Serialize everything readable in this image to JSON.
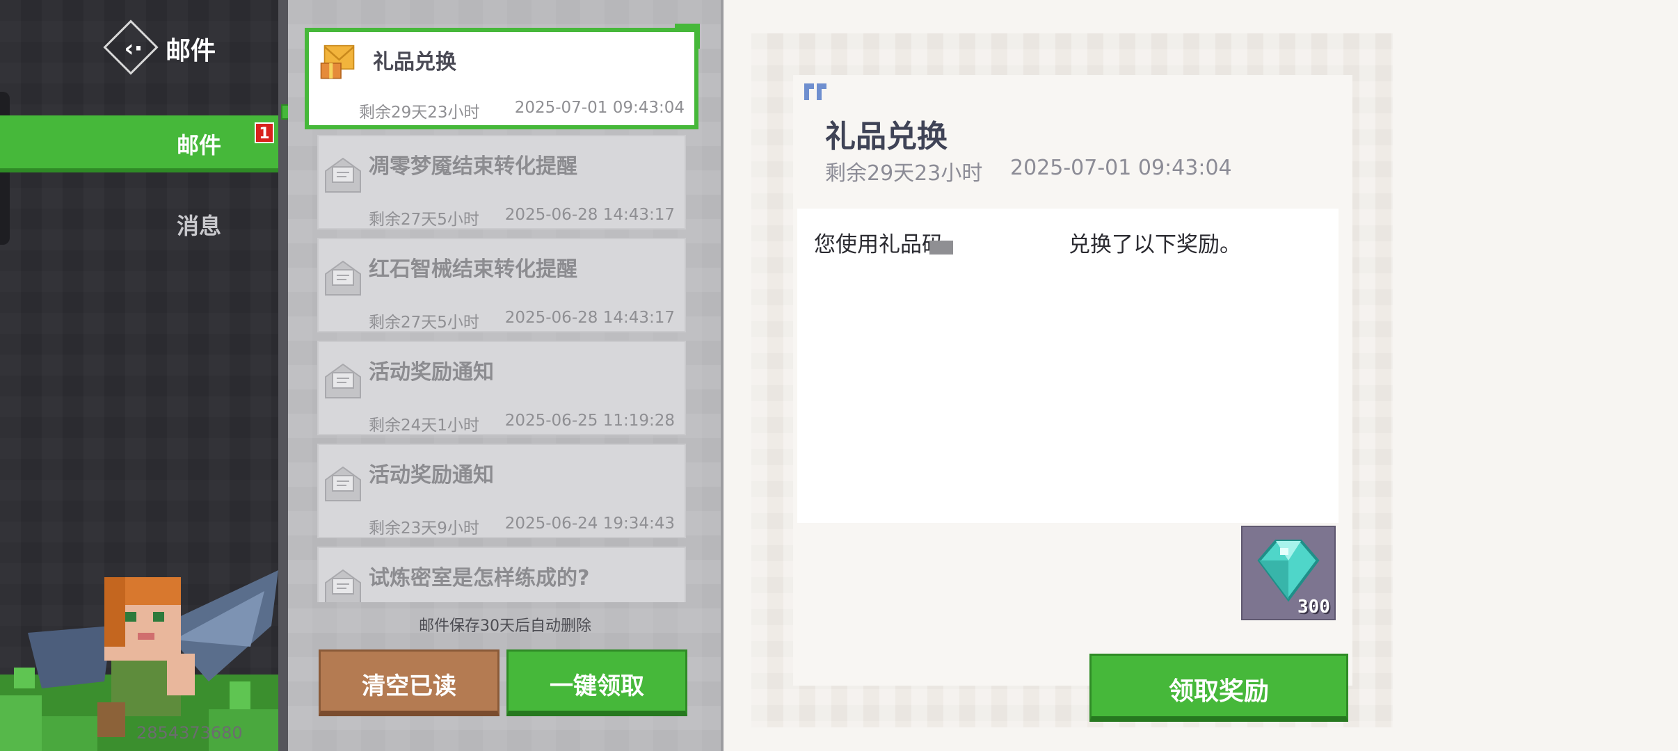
{
  "header": {
    "title": "邮件"
  },
  "sidebar": {
    "tabs": [
      {
        "label": "邮件",
        "badge": "1"
      },
      {
        "label": "消息"
      }
    ],
    "player_id": "2854373680"
  },
  "mail_list": {
    "items": [
      {
        "title": "礼品兑换",
        "remaining": "剩余29天23小时",
        "date": "2025-07-01 09:43:04",
        "selected": true
      },
      {
        "title": "凋零梦魇结束转化提醒",
        "remaining": "剩余27天5小时",
        "date": "2025-06-28 14:43:17"
      },
      {
        "title": "红石智械结束转化提醒",
        "remaining": "剩余27天5小时",
        "date": "2025-06-28 14:43:17"
      },
      {
        "title": "活动奖励通知",
        "remaining": "剩余24天1小时",
        "date": "2025-06-25 11:19:28"
      },
      {
        "title": "活动奖励通知",
        "remaining": "剩余23天9小时",
        "date": "2025-06-24 19:34:43"
      },
      {
        "title": "试炼密室是怎样练成的?",
        "remaining": "",
        "date": ""
      }
    ],
    "footer_note": "邮件保存30天后自动删除",
    "clear_button": "清空已读",
    "claim_all_button": "一键领取"
  },
  "detail": {
    "title": "礼品兑换",
    "remaining": "剩余29天23小时",
    "date": "2025-07-01 09:43:04",
    "body_prefix": "您使用礼品码",
    "body_suffix": "兑换了以下奖励。",
    "reward": {
      "icon": "diamond-icon",
      "count": "300"
    },
    "claim_button": "领取奖励"
  },
  "colors": {
    "accent_green": "#46b83a",
    "brown_button": "#b47b52",
    "badge_red": "#d8221c"
  }
}
